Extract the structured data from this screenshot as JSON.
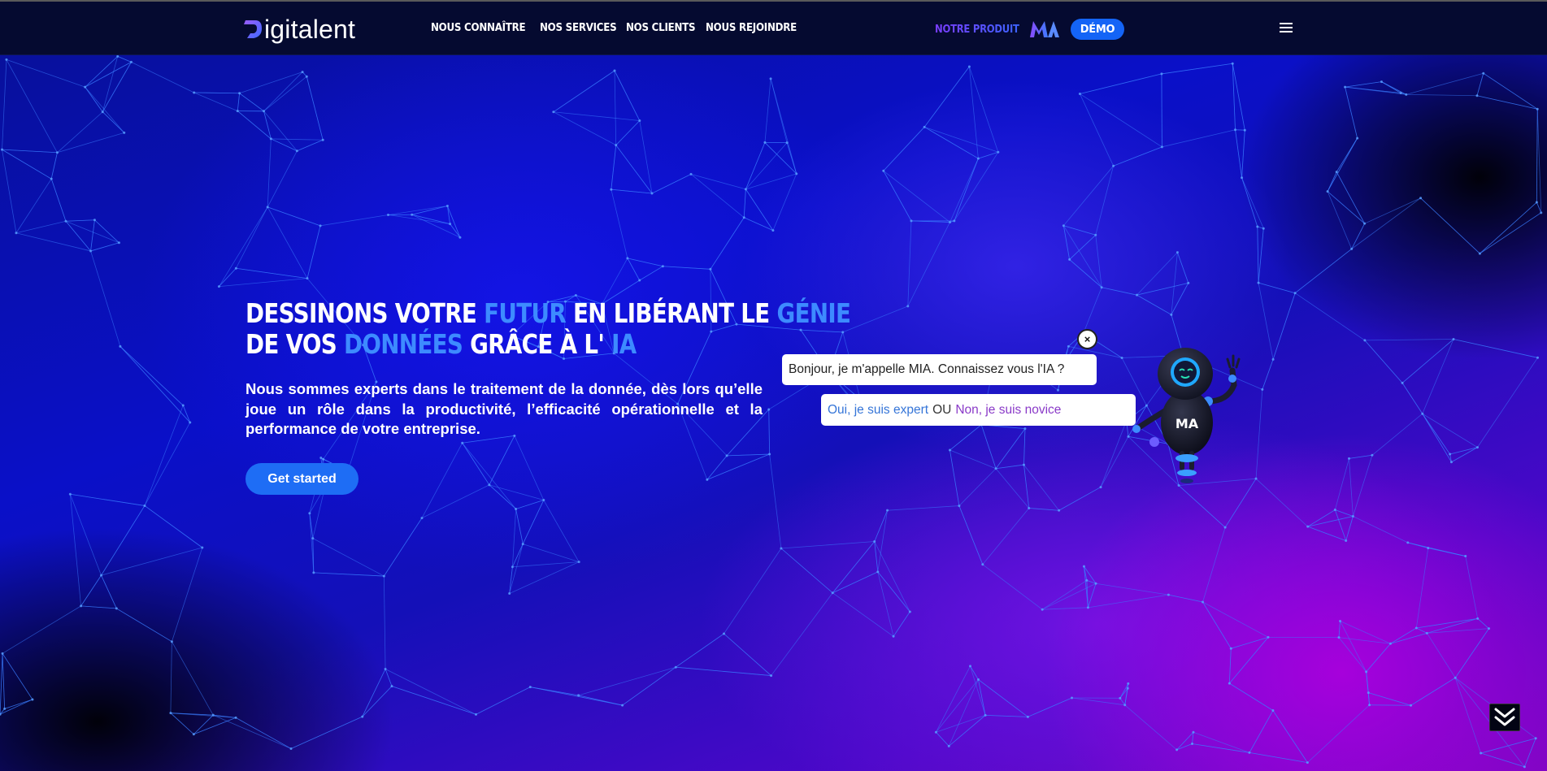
{
  "brand": {
    "logo_text": "igitalent"
  },
  "nav": {
    "links": [
      "NOUS CONNAÎTRE",
      "NOS SERVICES",
      "NOS CLIENTS",
      "NOUS REJOINDRE"
    ],
    "product_label": "NOTRE PRODUIT",
    "demo_label": "DÉMO",
    "menu_icon": "hamburger-icon"
  },
  "hero": {
    "headline": {
      "p1": "DESSINONS VOTRE ",
      "h1": "FUTUR",
      "p2": " EN LIBÉRANT LE ",
      "h2": "GÉNIE",
      "p3": "DE VOS ",
      "h3": "DONNÉES",
      "p4": " GRÂCE À L' ",
      "h4": "IA"
    },
    "subtext": "Nous sommes experts dans le traitement de la donnée, dès lors qu’elle joue un rôle dans la productivité, l’efficacité opérationnelle et la performance de votre entreprise.",
    "cta_label": "Get started"
  },
  "chatbot": {
    "greeting": "Bonjour, je m'appelle MIA. Connaissez vous l'IA ?",
    "close_symbol": "×",
    "choice_expert": "Oui, je suis expert",
    "choice_separator": "OU",
    "choice_novice": "Non, je suis novice",
    "badge_text": "MA"
  },
  "scroll_icon": "double-chevron-down-icon",
  "colors": {
    "nav_bg": "#050a30",
    "accent_blue": "#3d8bff",
    "button_blue": "#1e6df5",
    "novice_purple": "#8a3ac8"
  }
}
